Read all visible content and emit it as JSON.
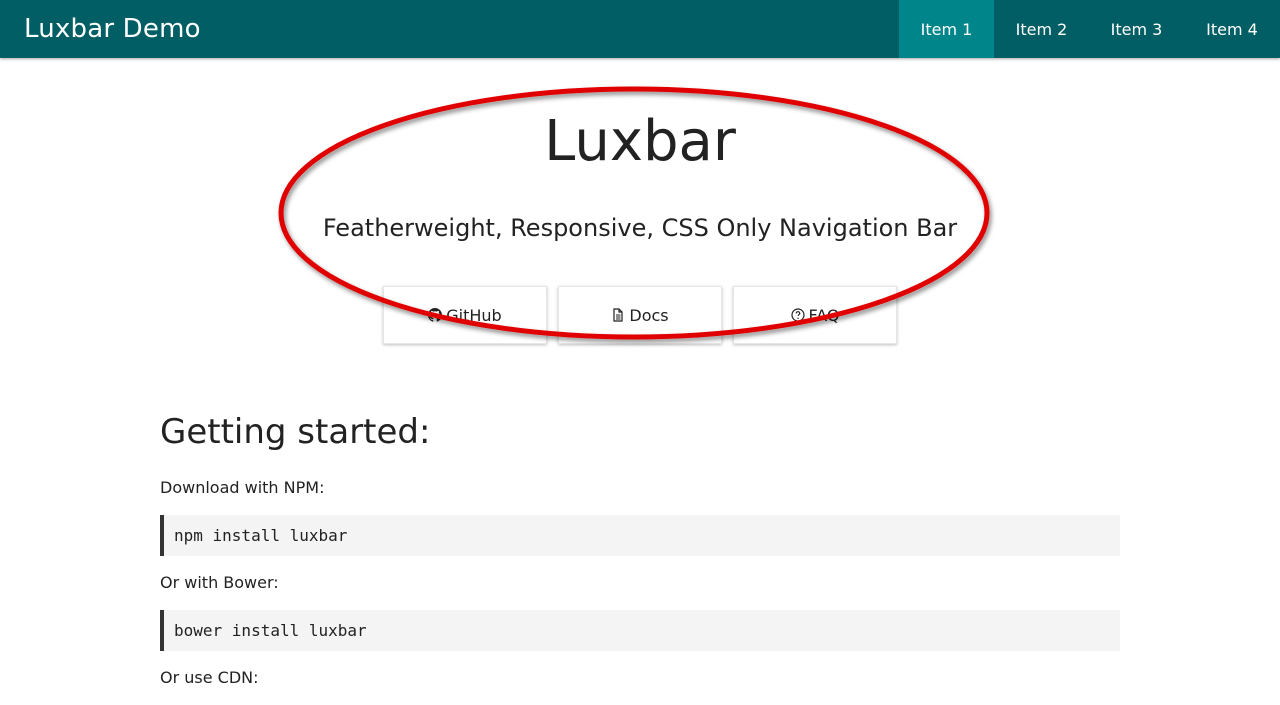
{
  "navbar": {
    "brand": "Luxbar Demo",
    "items": [
      {
        "label": "Item 1",
        "active": true
      },
      {
        "label": "Item 2",
        "active": false
      },
      {
        "label": "Item 3",
        "active": false
      },
      {
        "label": "Item 4",
        "active": false
      }
    ],
    "background_color": "#005e64",
    "active_color": "#00858b"
  },
  "hero": {
    "title": "Luxbar",
    "subtitle": "Featherweight, Responsive, CSS Only Navigation Bar",
    "buttons": [
      {
        "label": "GitHub",
        "icon": "github-icon"
      },
      {
        "label": "Docs",
        "icon": "document-icon"
      },
      {
        "label": "FAQ",
        "icon": "question-circle-icon"
      }
    ]
  },
  "annotation": {
    "shape": "ellipse",
    "color": "#e00000"
  },
  "getting_started": {
    "title": "Getting started:",
    "npm_label": "Download with NPM:",
    "npm_command": "npm install luxbar",
    "bower_label": "Or with Bower:",
    "bower_command": "bower install luxbar",
    "cdn_label": "Or use CDN:"
  }
}
